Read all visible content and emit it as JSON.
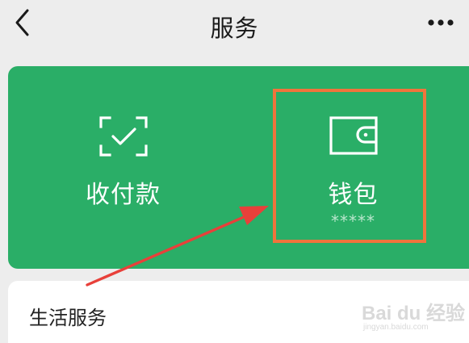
{
  "header": {
    "title": "服务",
    "back_icon": "chevron-left-icon",
    "more_icon": "ellipsis-icon"
  },
  "wallet_card": {
    "background_color": "#2aae67",
    "pay": {
      "label": "收付款",
      "icon": "scan-check-icon"
    },
    "wallet": {
      "label": "钱包",
      "icon": "wallet-icon",
      "balance_masked": "*****"
    }
  },
  "life_services": {
    "title": "生活服务"
  },
  "annotation": {
    "highlight_color": "#f0743c",
    "arrow_color": "#e8403a"
  },
  "watermark": {
    "logo": "Bai du 经验",
    "url": "jingyan.baidu.com"
  }
}
